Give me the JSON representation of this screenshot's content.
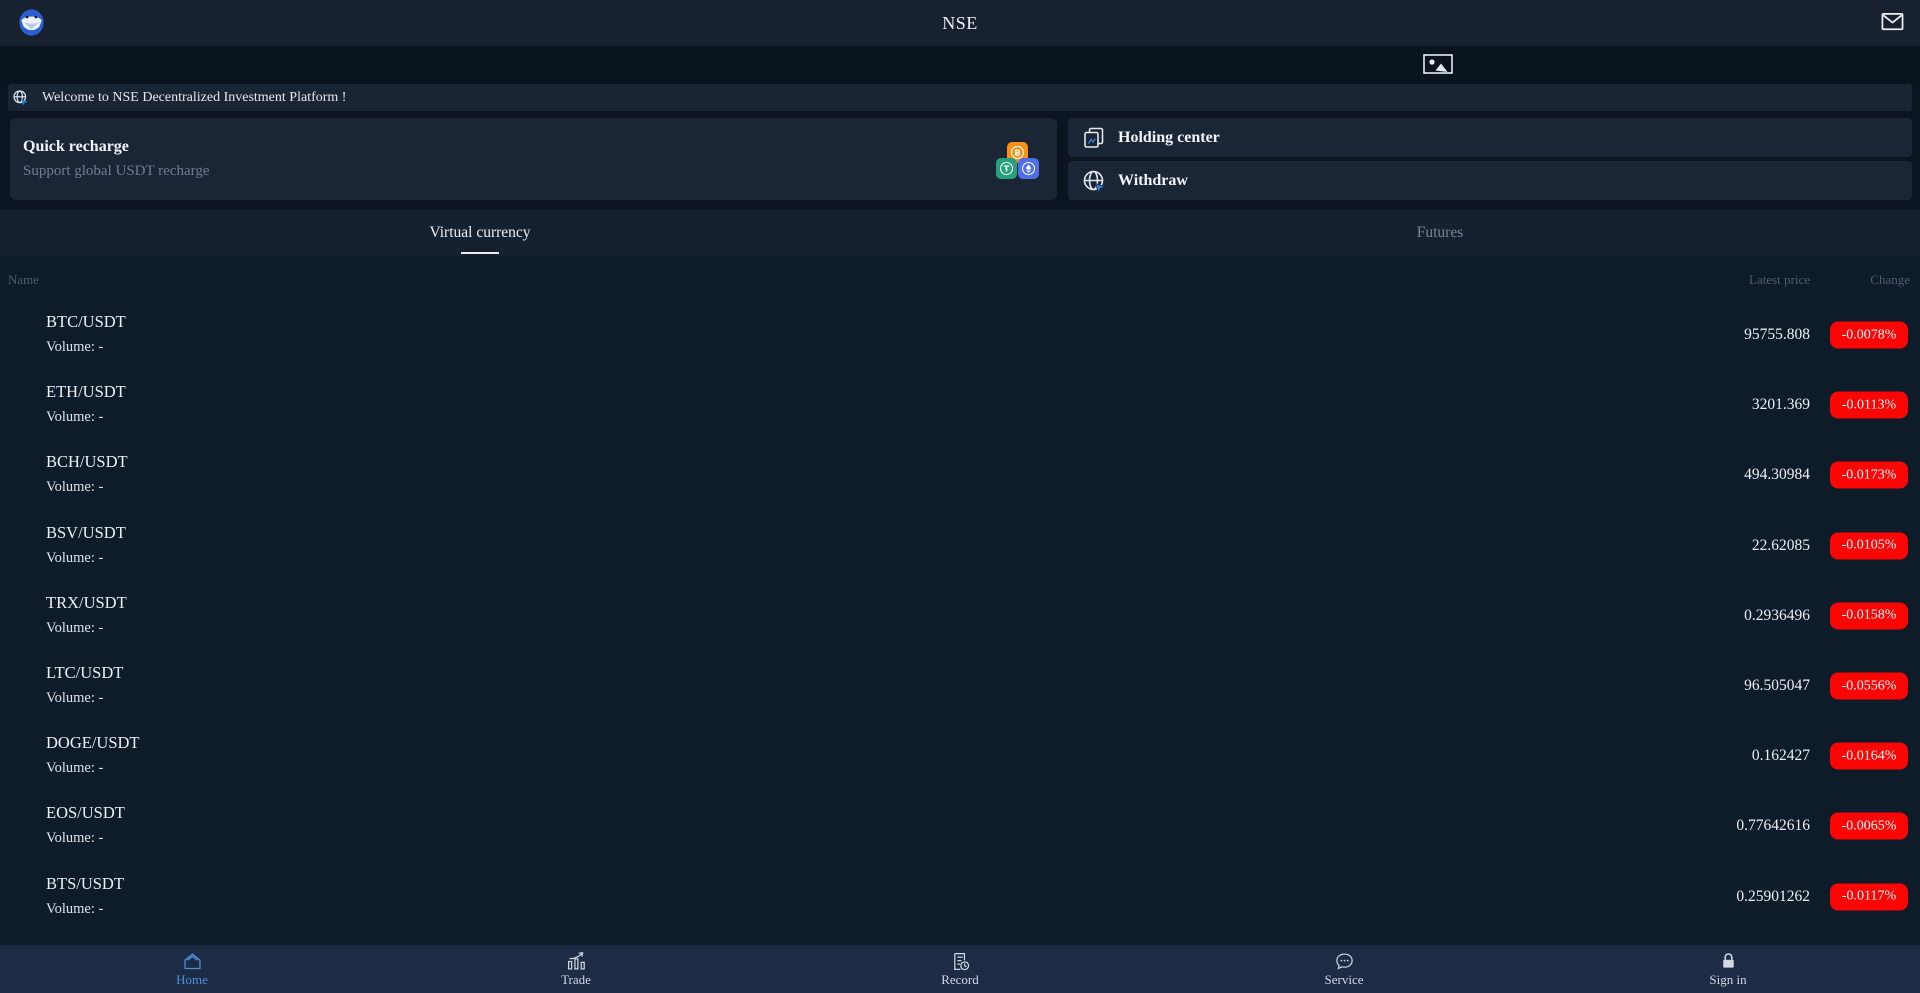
{
  "colors": {
    "accent-blue": "#4a90d9",
    "negative-red": "#fb0505",
    "btc-orange": "#f7931a",
    "usdt-green": "#27a17c",
    "eth-blue": "#4f6fe8"
  },
  "topbar": {
    "title": "NSE",
    "logo_icon": "mascot-logo",
    "mail_icon": "mail-icon"
  },
  "banner": {
    "placeholder_icon": "broken-image-icon"
  },
  "announcement": {
    "icon": "globe-arrow-icon",
    "text": "Welcome to NSE Decentralized Investment Platform !"
  },
  "quick_recharge": {
    "title": "Quick recharge",
    "subtitle": "Support global USDT recharge",
    "coin_icons": [
      "bitcoin-icon",
      "tether-icon",
      "ethereum-icon"
    ]
  },
  "actions": [
    {
      "label": "Holding center",
      "icon": "holding-center-icon"
    },
    {
      "label": "Withdraw",
      "icon": "withdraw-globe-icon"
    }
  ],
  "tabs": [
    {
      "label": "Virtual currency",
      "active": true
    },
    {
      "label": "Futures",
      "active": false
    }
  ],
  "market_table": {
    "columns": {
      "name": "Name",
      "price": "Latest price",
      "change": "Change"
    },
    "volume_prefix": "Volume:",
    "rows": [
      {
        "pair": "BTC/USDT",
        "volume": "-",
        "price": "95755.808",
        "change": "-0.0078%"
      },
      {
        "pair": "ETH/USDT",
        "volume": "-",
        "price": "3201.369",
        "change": "-0.0113%"
      },
      {
        "pair": "BCH/USDT",
        "volume": "-",
        "price": "494.30984",
        "change": "-0.0173%"
      },
      {
        "pair": "BSV/USDT",
        "volume": "-",
        "price": "22.62085",
        "change": "-0.0105%"
      },
      {
        "pair": "TRX/USDT",
        "volume": "-",
        "price": "0.2936496",
        "change": "-0.0158%"
      },
      {
        "pair": "LTC/USDT",
        "volume": "-",
        "price": "96.505047",
        "change": "-0.0556%"
      },
      {
        "pair": "DOGE/USDT",
        "volume": "-",
        "price": "0.162427",
        "change": "-0.0164%"
      },
      {
        "pair": "EOS/USDT",
        "volume": "-",
        "price": "0.77642616",
        "change": "-0.0065%"
      },
      {
        "pair": "BTS/USDT",
        "volume": "-",
        "price": "0.25901262",
        "change": "-0.0117%"
      }
    ]
  },
  "bottom_nav": {
    "items": [
      {
        "label": "Home",
        "icon": "home-icon",
        "active": true
      },
      {
        "label": "Trade",
        "icon": "trade-icon",
        "active": false
      },
      {
        "label": "Record",
        "icon": "record-icon",
        "active": false
      },
      {
        "label": "Service",
        "icon": "service-icon",
        "active": false
      },
      {
        "label": "Sign in",
        "icon": "lock-icon",
        "active": false
      }
    ]
  }
}
